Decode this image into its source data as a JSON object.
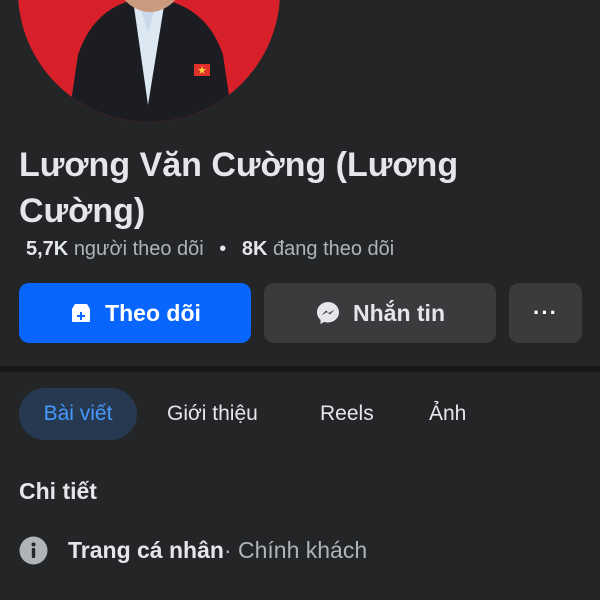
{
  "profile": {
    "name": "Lương Văn Cường (Lương Cường)",
    "followers_count": "5,7K",
    "followers_label": "người theo dõi",
    "following_count": "8K",
    "following_label": "đang theo dõi",
    "separator": "•"
  },
  "actions": {
    "follow_label": "Theo dõi",
    "message_label": "Nhắn tin",
    "more_label": "···"
  },
  "tabs": [
    {
      "label": "Bài viết",
      "active": true
    },
    {
      "label": "Giới thiệu",
      "active": false
    },
    {
      "label": "Reels",
      "active": false
    },
    {
      "label": "Ảnh",
      "active": false
    }
  ],
  "details": {
    "title": "Chi tiết",
    "page_type": "Trang cá nhân",
    "category": " · Chính khách"
  },
  "colors": {
    "background": "#242526",
    "primary": "#0866ff",
    "secondary_button": "#3a3b3c",
    "active_tab_bg": "#263951",
    "active_tab_text": "#4599ff",
    "avatar_bg": "#d8202a"
  },
  "icons": {
    "follow": "follow-page-icon",
    "message": "messenger-icon",
    "info": "info-icon"
  }
}
